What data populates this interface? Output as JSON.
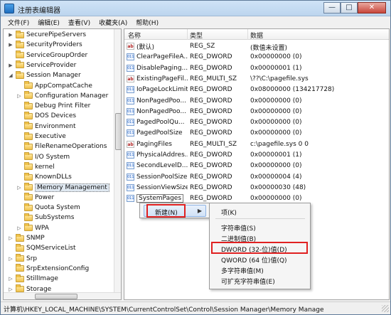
{
  "window": {
    "title": "注册表编辑器",
    "min_glyph": "—",
    "max_glyph": "□",
    "close_glyph": "✕"
  },
  "menu": [
    "文件(F)",
    "编辑(E)",
    "查看(V)",
    "收藏夹(A)",
    "帮助(H)"
  ],
  "tree": [
    {
      "label": "SecurePipeServers",
      "level": 0,
      "expander": "▶"
    },
    {
      "label": "SecurityProviders",
      "level": 0,
      "expander": "▶"
    },
    {
      "label": "ServiceGroupOrder",
      "level": 0,
      "expander": ""
    },
    {
      "label": "ServiceProvider",
      "level": 0,
      "expander": "▶"
    },
    {
      "label": "Session Manager",
      "level": 0,
      "expander": "◢"
    },
    {
      "label": "AppCompatCache",
      "level": 1,
      "expander": ""
    },
    {
      "label": "Configuration Manager",
      "level": 1,
      "expander": "▷"
    },
    {
      "label": "Debug Print Filter",
      "level": 1,
      "expander": ""
    },
    {
      "label": "DOS Devices",
      "level": 1,
      "expander": ""
    },
    {
      "label": "Environment",
      "level": 1,
      "expander": ""
    },
    {
      "label": "Executive",
      "level": 1,
      "expander": ""
    },
    {
      "label": "FileRenameOperations",
      "level": 1,
      "expander": ""
    },
    {
      "label": "I/O System",
      "level": 1,
      "expander": ""
    },
    {
      "label": "kernel",
      "level": 1,
      "expander": ""
    },
    {
      "label": "KnownDLLs",
      "level": 1,
      "expander": ""
    },
    {
      "label": "Memory Management",
      "level": 1,
      "expander": "▷",
      "selected": true
    },
    {
      "label": "Power",
      "level": 1,
      "expander": ""
    },
    {
      "label": "Quota System",
      "level": 1,
      "expander": ""
    },
    {
      "label": "SubSystems",
      "level": 1,
      "expander": ""
    },
    {
      "label": "WPA",
      "level": 1,
      "expander": "▷"
    },
    {
      "label": "SNMP",
      "level": 0,
      "expander": "▷"
    },
    {
      "label": "SQMServiceList",
      "level": 0,
      "expander": ""
    },
    {
      "label": "Srp",
      "level": 0,
      "expander": "▷"
    },
    {
      "label": "SrpExtensionConfig",
      "level": 0,
      "expander": ""
    },
    {
      "label": "StillImage",
      "level": 0,
      "expander": "▷"
    },
    {
      "label": "Storage",
      "level": 0,
      "expander": "▷"
    }
  ],
  "list": {
    "columns": {
      "name": "名称",
      "type": "类型",
      "data": "数据"
    },
    "rows": [
      {
        "icon": "ab",
        "name": "(默认)",
        "type": "REG_SZ",
        "data": "(数值未设置)"
      },
      {
        "icon": "bin",
        "name": "ClearPageFileA...",
        "type": "REG_DWORD",
        "data": "0x00000000 (0)"
      },
      {
        "icon": "bin",
        "name": "DisablePaging...",
        "type": "REG_DWORD",
        "data": "0x00000001 (1)"
      },
      {
        "icon": "ab",
        "name": "ExistingPageFil...",
        "type": "REG_MULTI_SZ",
        "data": "\\??\\C:\\pagefile.sys"
      },
      {
        "icon": "bin",
        "name": "IoPageLockLimit",
        "type": "REG_DWORD",
        "data": "0x08000000 (134217728)"
      },
      {
        "icon": "bin",
        "name": "NonPagedPoo...",
        "type": "REG_DWORD",
        "data": "0x00000000 (0)"
      },
      {
        "icon": "bin",
        "name": "NonPagedPoo...",
        "type": "REG_DWORD",
        "data": "0x00000000 (0)"
      },
      {
        "icon": "bin",
        "name": "PagedPoolQu...",
        "type": "REG_DWORD",
        "data": "0x00000000 (0)"
      },
      {
        "icon": "bin",
        "name": "PagedPoolSize",
        "type": "REG_DWORD",
        "data": "0x00000000 (0)"
      },
      {
        "icon": "ab",
        "name": "PagingFiles",
        "type": "REG_MULTI_SZ",
        "data": "c:\\pagefile.sys 0 0"
      },
      {
        "icon": "bin",
        "name": "PhysicalAddres...",
        "type": "REG_DWORD",
        "data": "0x00000001 (1)"
      },
      {
        "icon": "bin",
        "name": "SecondLevelD...",
        "type": "REG_DWORD",
        "data": "0x00000000 (0)"
      },
      {
        "icon": "bin",
        "name": "SessionPoolSize",
        "type": "REG_DWORD",
        "data": "0x00000004 (4)"
      },
      {
        "icon": "bin",
        "name": "SessionViewSize",
        "type": "REG_DWORD",
        "data": "0x00000030 (48)"
      },
      {
        "icon": "bin",
        "name": "SystemPages",
        "type": "REG_DWORD",
        "data": "0x00000000 (0)",
        "selected": true
      }
    ]
  },
  "context_menu": {
    "new_label": "新建(N)",
    "arrow": "▶"
  },
  "submenu": {
    "items": [
      "项(K)",
      "字符串值(S)",
      "二进制值(B)",
      "DWORD (32-位)值(D)",
      "QWORD (64 位)值(Q)",
      "多字符串值(M)",
      "可扩充字符串值(E)"
    ]
  },
  "status": {
    "path": "计算机\\HKEY_LOCAL_MACHINE\\SYSTEM\\CurrentControlSet\\Control\\Session Manager\\Memory Manage"
  },
  "colors": {
    "highlight": "#e02020",
    "menu_hover": "#d1e2f6"
  }
}
